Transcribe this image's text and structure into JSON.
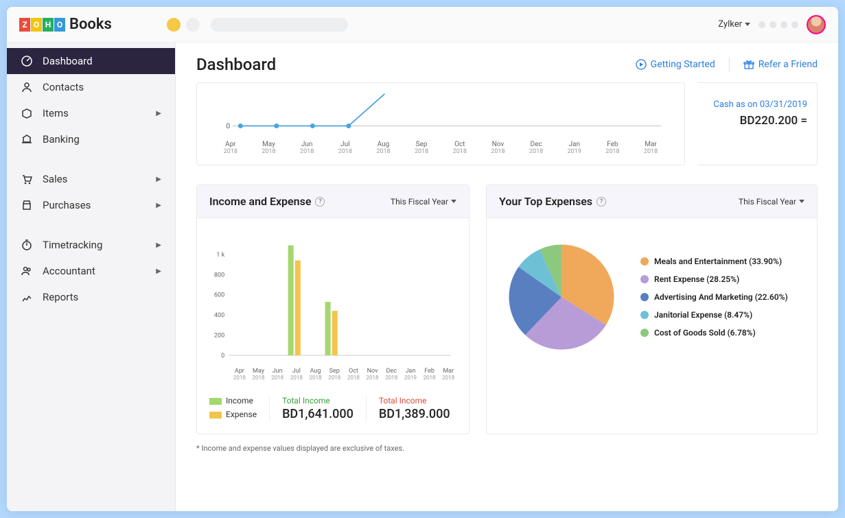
{
  "app_name": "Books",
  "org": "Zylker",
  "page_title": "Dashboard",
  "header_links": {
    "getting_started": "Getting Started",
    "refer": "Refer a Friend"
  },
  "sidebar": [
    {
      "label": "Dashboard",
      "icon": "dashboard",
      "active": true
    },
    {
      "label": "Contacts",
      "icon": "contacts"
    },
    {
      "label": "Items",
      "icon": "items",
      "expand": true
    },
    {
      "label": "Banking",
      "icon": "banking"
    },
    {
      "gap": true
    },
    {
      "label": "Sales",
      "icon": "sales",
      "expand": true
    },
    {
      "label": "Purchases",
      "icon": "purchases",
      "expand": true
    },
    {
      "gap": true
    },
    {
      "label": "Timetracking",
      "icon": "time",
      "expand": true
    },
    {
      "label": "Accountant",
      "icon": "accountant",
      "expand": true
    },
    {
      "label": "Reports",
      "icon": "reports"
    }
  ],
  "cash_panel": {
    "title": "Cash as on 03/31/2019",
    "value": "BD220.200 ="
  },
  "income_card": {
    "title": "Income and Expense",
    "period": "This Fiscal Year",
    "legend_income": "Income",
    "legend_expense": "Expense",
    "total_income_label": "Total Income",
    "total_income_value": "BD1,641.000",
    "total_expense_label": "Total Income",
    "total_expense_value": "BD1,389.000"
  },
  "expenses_card": {
    "title": "Your Top Expenses",
    "period": "This Fiscal Year"
  },
  "note": "* Income and expense values displayed are exclusive of taxes.",
  "chart_data": [
    {
      "type": "line",
      "title": "Cash flow",
      "categories": [
        "Apr 2018",
        "May 2018",
        "Jun 2018",
        "Jul 2018",
        "Aug 2018",
        "Sep 2018",
        "Oct 2018",
        "Nov 2018",
        "Dec 2018",
        "Jan 2019",
        "Feb 2018",
        "Mar 2018"
      ],
      "series": [
        {
          "name": "Cash",
          "values": [
            0,
            0,
            0,
            0,
            220,
            null,
            null,
            null,
            null,
            null,
            null,
            null
          ]
        }
      ],
      "ylim": [
        0,
        250
      ]
    },
    {
      "type": "bar",
      "title": "Income and Expense",
      "categories": [
        "Apr 2018",
        "May 2018",
        "Jun 2018",
        "Jul 2018",
        "Aug 2018",
        "Sep 2018",
        "Oct 2018",
        "Nov 2018",
        "Dec 2018",
        "Jan 2019",
        "Feb 2018",
        "Mar 2018"
      ],
      "series": [
        {
          "name": "Income",
          "values": [
            0,
            0,
            0,
            1090,
            0,
            530,
            0,
            0,
            0,
            0,
            0,
            0
          ]
        },
        {
          "name": "Expense",
          "values": [
            0,
            0,
            0,
            940,
            0,
            440,
            0,
            0,
            0,
            0,
            0,
            0
          ]
        }
      ],
      "ylabel": "",
      "y_ticks": [
        0,
        200,
        400,
        600,
        800,
        "1 k"
      ],
      "ylim": [
        0,
        1100
      ]
    },
    {
      "type": "pie",
      "title": "Your Top Expenses",
      "slices": [
        {
          "name": "Meals and Entertainment",
          "pct": 33.9,
          "color": "#f0a95b"
        },
        {
          "name": "Rent Expense",
          "pct": 28.25,
          "color": "#b79cd8"
        },
        {
          "name": "Advertising And Marketing",
          "pct": 22.6,
          "color": "#5a7fc0"
        },
        {
          "name": "Janitorial Expense",
          "pct": 8.47,
          "color": "#6ec1d4"
        },
        {
          "name": "Cost of Goods Sold",
          "pct": 6.78,
          "color": "#8cc97e"
        }
      ]
    }
  ]
}
